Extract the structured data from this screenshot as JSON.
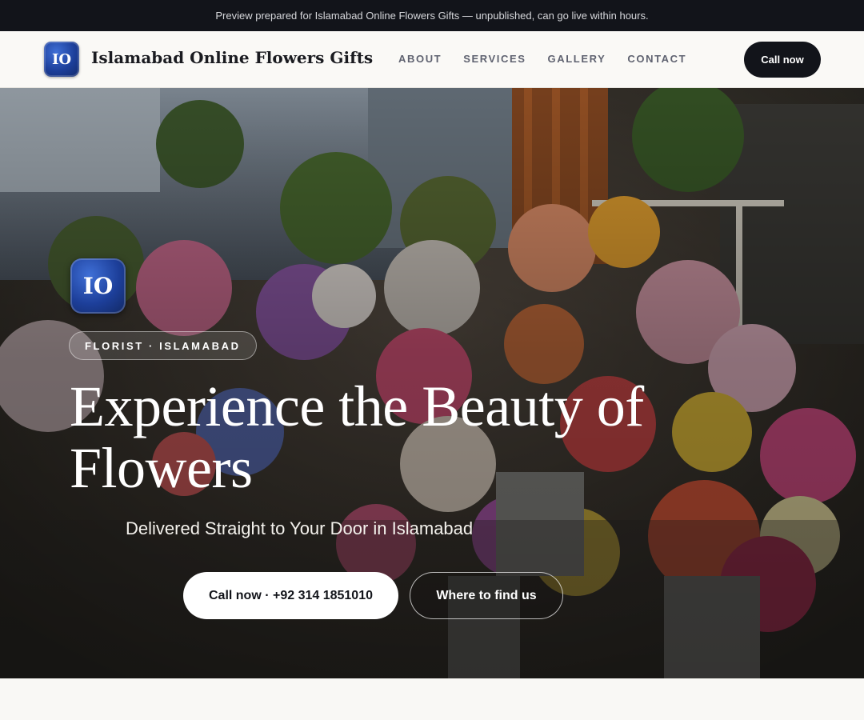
{
  "announcement": "Preview prepared for Islamabad Online Flowers Gifts — unpublished, can go live within hours.",
  "brand": {
    "initials": "IO",
    "name": "Islamabad Online Flowers Gifts"
  },
  "nav": {
    "links": [
      "ABOUT",
      "SERVICES",
      "GALLERY",
      "CONTACT"
    ],
    "cta": "Call now"
  },
  "hero": {
    "logo_initials": "IO",
    "badge": "FLORIST · ISLAMABAD",
    "title": "Experience the Beauty of Flowers",
    "subtitle": "Delivered Straight to Your Door in Islamabad",
    "primary_button": "Call now · +92 314 1851010",
    "secondary_button": "Where to find us",
    "background_image": "flower-shop-photo"
  },
  "colors": {
    "dark": "#12141a",
    "brand_blue": "#1d3f9a",
    "page_bg": "#f9f8f5"
  }
}
